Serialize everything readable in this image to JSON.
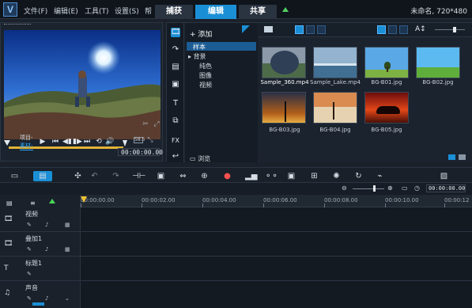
{
  "menu": {
    "file": "文件(F)",
    "edit": "编辑(E)",
    "tools": "工具(T)",
    "settings": "设置(S)",
    "help": "帮"
  },
  "tabs": {
    "capture": "捕获",
    "edit": "编辑",
    "share": "共享"
  },
  "project": {
    "title": "未命名, 720*480"
  },
  "preview": {
    "mode_project": "项目-",
    "mode_material": "素材-",
    "timecode": "00:00:00.00",
    "speed": "58.5"
  },
  "library": {
    "add_label": "添加",
    "browse_label": "浏览",
    "folders": [
      "样本",
      "背景",
      "纯色",
      "图像",
      "视频"
    ],
    "items": [
      {
        "name": "Sample_360.mp4"
      },
      {
        "name": "Sample_Lake.mp4"
      },
      {
        "name": "BG-B01.jpg"
      },
      {
        "name": "BG-B02.jpg"
      },
      {
        "name": "BG-B03.jpg"
      },
      {
        "name": "BG-B04.jpg"
      },
      {
        "name": "BG-B05.jpg"
      }
    ],
    "lib_icons": [
      "media-icon",
      "transition-icon",
      "title-icon",
      "graphic-icon",
      "text-icon",
      "effect-icon",
      "fx-icon",
      "path-icon"
    ]
  },
  "timeline": {
    "zoom_time": "00:00:00.00",
    "ticks": [
      "00:00:00.00",
      "00:00:02.00",
      "00:00:04.00",
      "00:00:06.00",
      "00:00:08.00",
      "00:00:10.00",
      "00:00:12"
    ],
    "tracks": [
      "视频",
      "叠加1",
      "标题1",
      "声音"
    ]
  },
  "colors": {
    "accent": "#1b8fd6",
    "scrub": "#e2b236",
    "panel": "#1b232e"
  }
}
